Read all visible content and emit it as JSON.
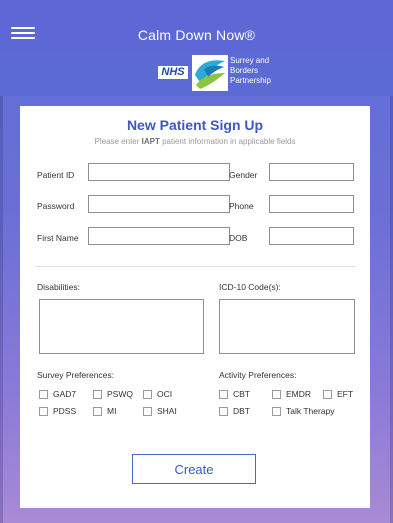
{
  "header": {
    "title": "Calm Down Now®"
  },
  "logos": {
    "nhs": "NHS",
    "partner_lines": [
      "Surrey and",
      "Borders",
      "Partnership"
    ]
  },
  "form": {
    "title": "New Patient Sign Up",
    "subtitle_pre": "Please enter ",
    "subtitle_bold": "IAPT",
    "subtitle_post": " patient information in applicable fields",
    "labels": {
      "patient_id": "Patient ID",
      "password": "Password",
      "first_name": "First Name",
      "gender": "Gender",
      "phone": "Phone",
      "dob": "DOB",
      "disabilities": "Disabilities:",
      "icd": "ICD-10 Code(s):",
      "survey": "Survey Preferences:",
      "activity": "Activity Preferences:"
    },
    "values": {
      "patient_id": "",
      "password": "",
      "first_name": "",
      "gender": "",
      "phone": "",
      "dob": "",
      "disabilities": "",
      "icd": ""
    },
    "survey_options": [
      "GAD7",
      "PSWQ",
      "OCI",
      "PDSS",
      "MI",
      "SHAI"
    ],
    "activity_options": [
      "CBT",
      "EMDR",
      "EFT",
      "DBT",
      "Talk Therapy"
    ],
    "create_label": "Create"
  },
  "colors": {
    "accent": "#3c57c9",
    "header": "#5d68d6"
  }
}
